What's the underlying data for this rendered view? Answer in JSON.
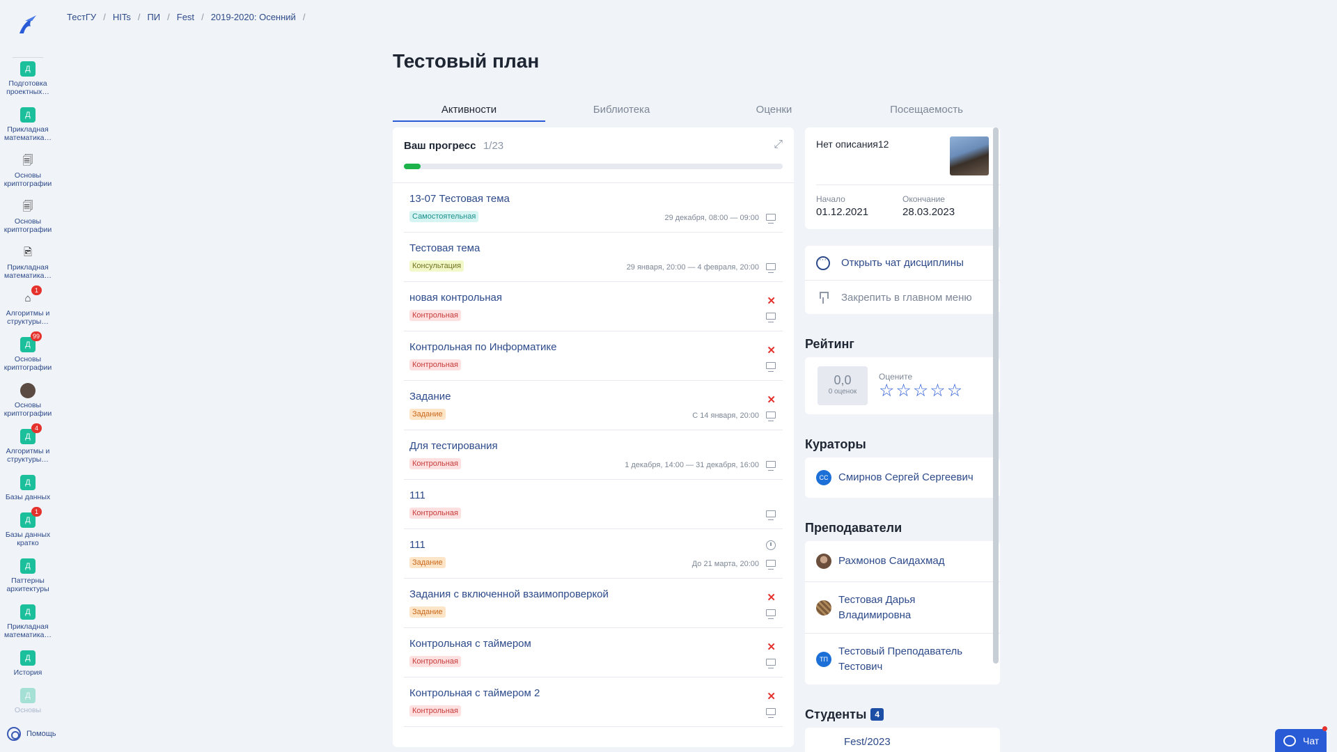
{
  "breadcrumbs": [
    "ТестГУ",
    "HITs",
    "ПИ",
    "Fest",
    "2019-2020: Осенний"
  ],
  "page_title": "Тестовый план",
  "tabs": [
    {
      "label": "Активности",
      "active": true
    },
    {
      "label": "Библиотека",
      "active": false
    },
    {
      "label": "Оценки",
      "active": false
    },
    {
      "label": "Посещаемость",
      "active": false
    }
  ],
  "sidebar": {
    "items": [
      {
        "icon": "Д",
        "label": "Подготовка проектных…"
      },
      {
        "icon": "Д",
        "label": "Прикладная математика…"
      },
      {
        "icon": "doc-icon",
        "label": "Основы криптографии"
      },
      {
        "icon": "doc-icon",
        "label": "Основы криптографии"
      },
      {
        "icon": "image-doc-icon",
        "label": "Прикладная математика…"
      },
      {
        "icon": "house-icon",
        "badge": "1",
        "label": "Алгоритмы и структуры…"
      },
      {
        "icon": "Д",
        "badge": "99",
        "label": "Основы криптографии"
      },
      {
        "icon": "user-photo",
        "label": "Основы криптографии"
      },
      {
        "icon": "Д",
        "badge": "4",
        "label": "Алгоритмы и структуры…"
      },
      {
        "icon": "Д",
        "label": "Базы данных"
      },
      {
        "icon": "Д",
        "badge": "1",
        "label": "Базы данных кратко"
      },
      {
        "icon": "Д",
        "label": "Паттерны архитектуры"
      },
      {
        "icon": "Д",
        "label": "Прикладная математика…"
      },
      {
        "icon": "Д",
        "label": "История"
      },
      {
        "icon": "Д",
        "label": "Основы"
      }
    ],
    "help_label": "Помощь"
  },
  "progress": {
    "title": "Ваш прогресс",
    "count": "1/23",
    "fraction": 0.0435
  },
  "activities": [
    {
      "title": "13-07 Тестовая тема",
      "tag": "Самостоятельная",
      "tag_type": "self",
      "date": "29 декабря, 08:00 — 09:00",
      "status": "none"
    },
    {
      "title": "Тестовая тема",
      "tag": "Консультация",
      "tag_type": "cons",
      "date": "29 января, 20:00 — 4 февраля, 20:00",
      "status": "none"
    },
    {
      "title": "новая контрольная",
      "tag": "Контрольная",
      "tag_type": "ctrl",
      "date": "",
      "status": "x"
    },
    {
      "title": "Контрольная по Информатике",
      "tag": "Контрольная",
      "tag_type": "ctrl",
      "date": "",
      "status": "x"
    },
    {
      "title": "Задание",
      "tag": "Задание",
      "tag_type": "task",
      "date": "С 14 января, 20:00",
      "status": "x"
    },
    {
      "title": "Для тестирования",
      "tag": "Контрольная",
      "tag_type": "ctrl",
      "date": "1 декабря, 14:00 — 31 декабря, 16:00",
      "status": "none"
    },
    {
      "title": "111",
      "tag": "Контрольная",
      "tag_type": "ctrl",
      "date": "",
      "status": "none"
    },
    {
      "title": "111",
      "tag": "Задание",
      "tag_type": "task",
      "date": "До 21 марта, 20:00",
      "status": "clock"
    },
    {
      "title": "Задания с включенной взаимопроверкой",
      "tag": "Задание",
      "tag_type": "task",
      "date": "",
      "status": "x"
    },
    {
      "title": "Контрольная с таймером",
      "tag": "Контрольная",
      "tag_type": "ctrl",
      "date": "",
      "status": "x"
    },
    {
      "title": "Контрольная с таймером 2",
      "tag": "Контрольная",
      "tag_type": "ctrl",
      "date": "",
      "status": "x"
    }
  ],
  "info": {
    "description": "Нет описания12",
    "start_label": "Начало",
    "start_value": "01.12.2021",
    "end_label": "Окончание",
    "end_value": "28.03.2023"
  },
  "actions": {
    "open_chat": "Открыть чат дисциплины",
    "pin": "Закрепить в главном меню"
  },
  "rating": {
    "title": "Рейтинг",
    "score": "0,0",
    "votes": "0 оценок",
    "rate_label": "Оцените",
    "stars_total": 5
  },
  "curators": {
    "title": "Кураторы",
    "people": [
      {
        "initials": "СС",
        "name": "Смирнов Сергей Сергеевич"
      }
    ]
  },
  "teachers": {
    "title": "Преподаватели",
    "people": [
      {
        "initials": "",
        "name": "Рахмонов Саидахмад"
      },
      {
        "initials": "",
        "name": "Тестовая Дарья Владимировна"
      },
      {
        "initials": "ТП",
        "name": "Тестовый Преподаватель Тестович"
      }
    ]
  },
  "students": {
    "title": "Студенты",
    "count": "4",
    "group": "Fest/2023"
  },
  "chat_button": "Чат"
}
